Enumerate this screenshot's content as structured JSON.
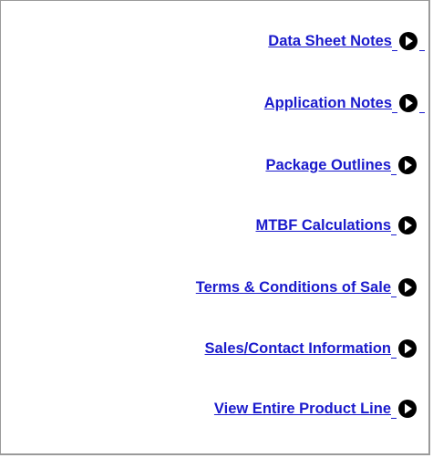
{
  "links": [
    {
      "label": "Data Sheet Notes"
    },
    {
      "label": "Application Notes"
    },
    {
      "label": "Package Outlines"
    },
    {
      "label": "MTBF Calculations"
    },
    {
      "label": "Terms & Conditions of Sale"
    },
    {
      "label": "Sales/Contact Information"
    },
    {
      "label": "View Entire Product Line"
    }
  ],
  "icons": {
    "arrow": "arrow-right-circle-icon",
    "color": "#000000"
  },
  "colors": {
    "link": "#1a1acc",
    "border": "#9a9a9a",
    "background": "#ffffff"
  }
}
